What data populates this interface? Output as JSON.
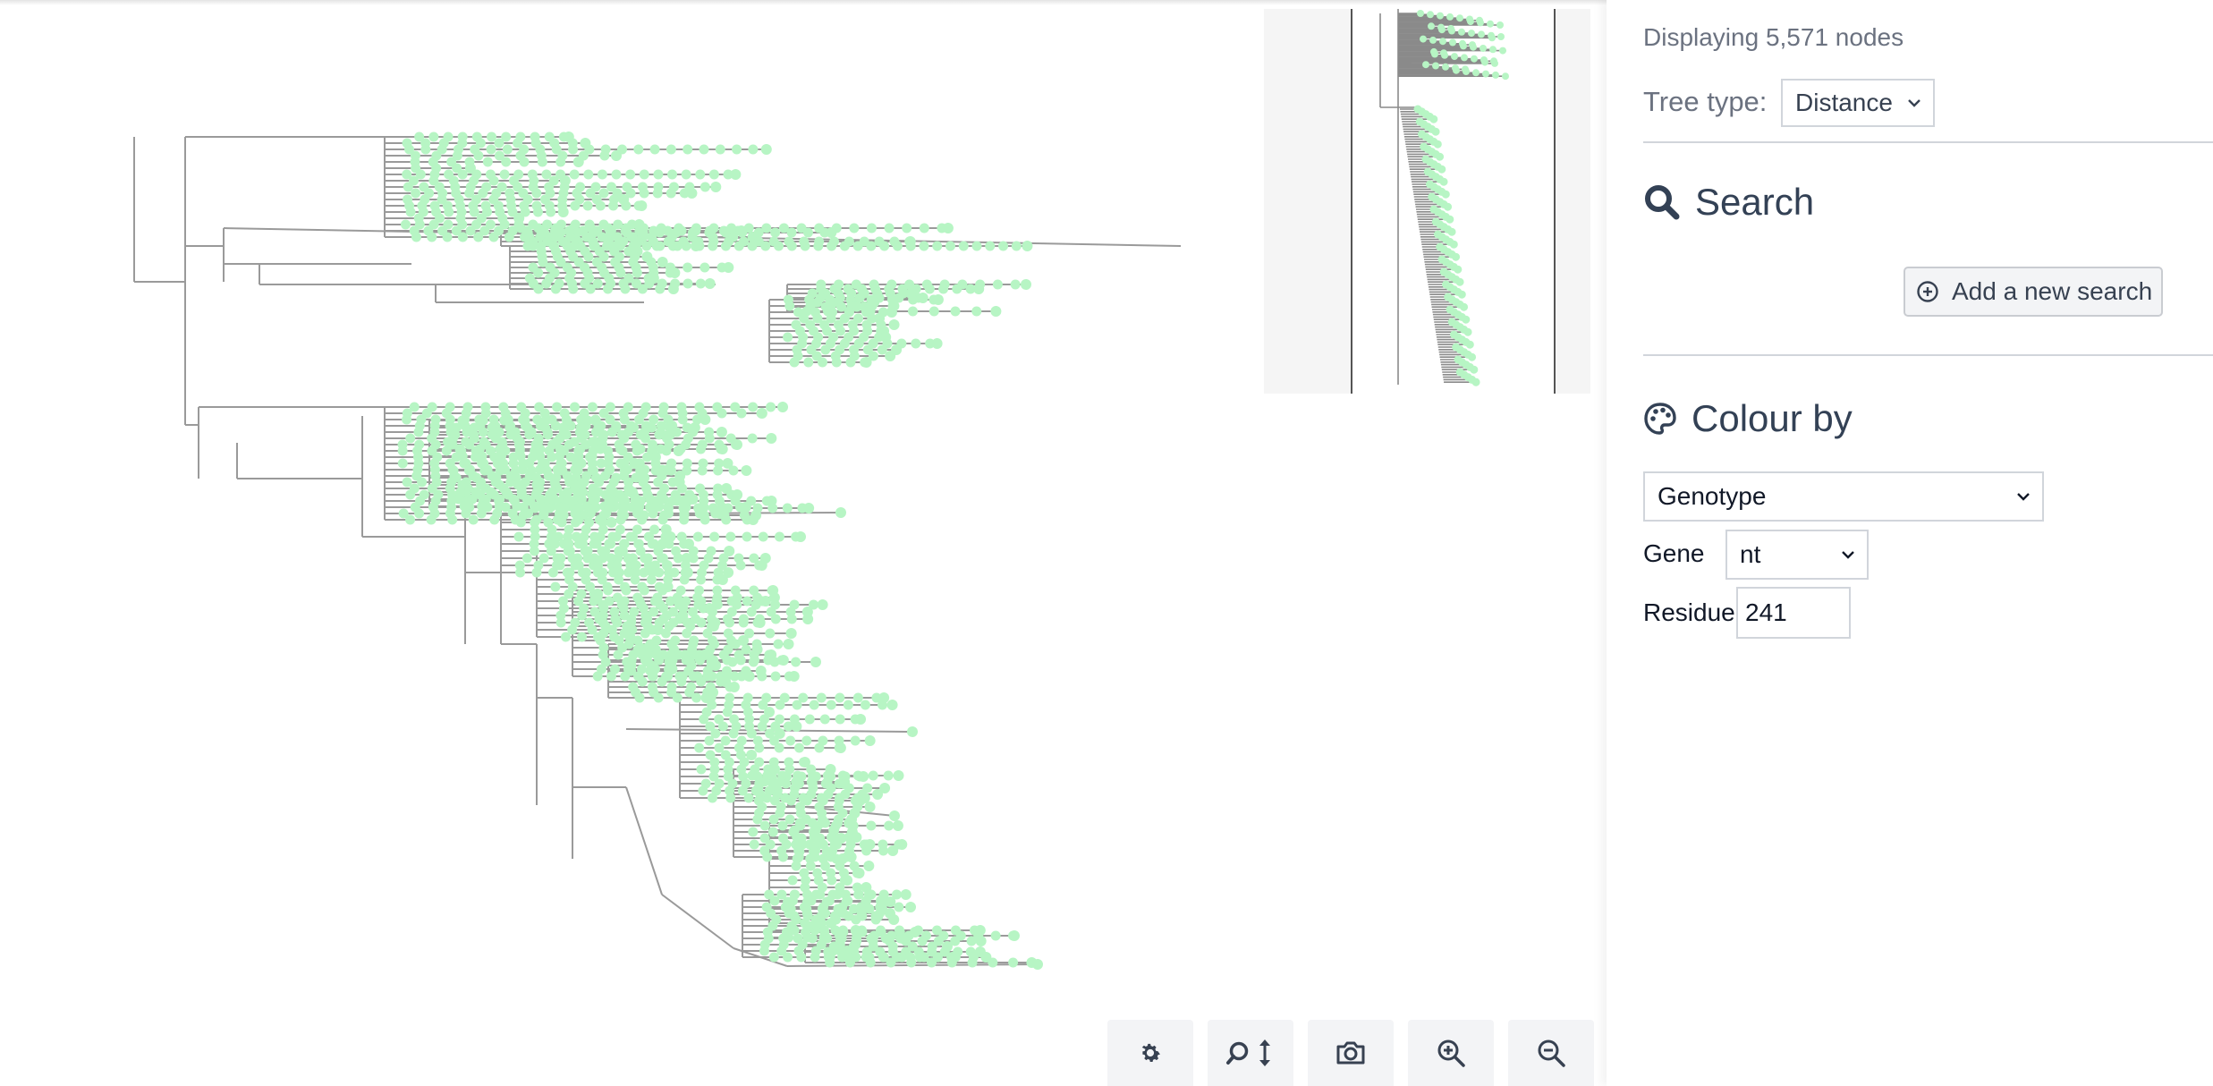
{
  "status": {
    "node_count_text": "Displaying 5,571 nodes"
  },
  "tree_type": {
    "label": "Tree type:",
    "value": "Distance"
  },
  "search": {
    "title": "Search",
    "add_button_label": "Add a new search"
  },
  "colour_by": {
    "title": "Colour by",
    "field_value": "Genotype",
    "gene_label": "Gene",
    "gene_value": "nt",
    "residue_label": "Residue",
    "residue_value": "241"
  },
  "toolbar": {
    "buttons": [
      {
        "name": "settings-button",
        "icon": "gear-icon"
      },
      {
        "name": "scroll-zoom-toggle-button",
        "icon": "zoom-vertical-icon"
      },
      {
        "name": "screenshot-button",
        "icon": "camera-icon"
      },
      {
        "name": "zoom-in-button",
        "icon": "zoom-in-icon"
      },
      {
        "name": "zoom-out-button",
        "icon": "zoom-out-icon"
      }
    ]
  },
  "colors": {
    "branch": "#9a9a9a",
    "tip": "#b7f5c4",
    "sidebar_heading": "#334155",
    "muted_text": "#6b7280"
  }
}
